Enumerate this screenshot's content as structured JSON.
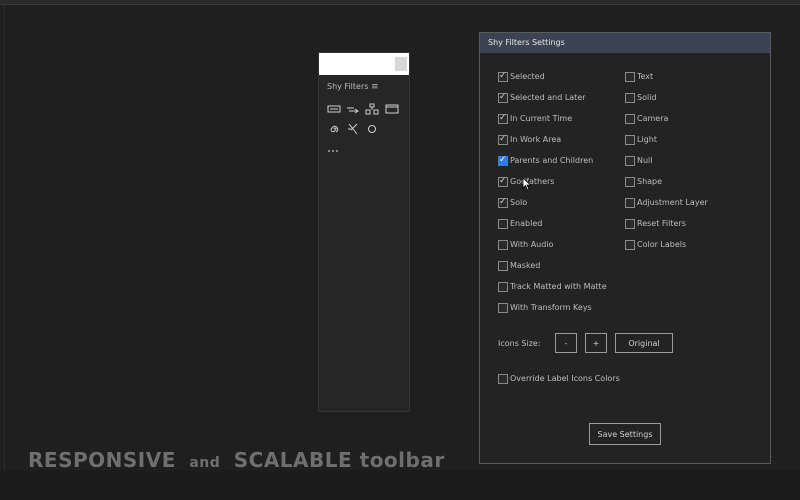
{
  "shy_panel": {
    "title": "Shy Filters",
    "menu_icon": "hamburger-menu-icon",
    "icons": [
      "text-layer-icon",
      "shape-arrow-icon",
      "hierarchy-icon",
      "film-clip-icon",
      "spiral-icon",
      "light-rays-icon",
      "circle-icon",
      "ellipsis-icon"
    ]
  },
  "settings": {
    "title": "Shy Filters Settings",
    "left_options": [
      {
        "label": "Selected",
        "checked": true
      },
      {
        "label": "Selected and Later",
        "checked": true
      },
      {
        "label": "In Current Time",
        "checked": true
      },
      {
        "label": "In Work Area",
        "checked": true
      },
      {
        "label": "Parents and Children",
        "checked": true,
        "highlight": true
      },
      {
        "label": "Godfathers",
        "checked": true
      },
      {
        "label": "Solo",
        "checked": true
      },
      {
        "label": "Enabled",
        "checked": false
      },
      {
        "label": "With Audio",
        "checked": false
      },
      {
        "label": "Masked",
        "checked": false
      },
      {
        "label": "Track Matted with Matte",
        "checked": false
      },
      {
        "label": "With Transform Keys",
        "checked": false
      }
    ],
    "right_options": [
      {
        "label": "Text",
        "checked": false
      },
      {
        "label": "Solid",
        "checked": false
      },
      {
        "label": "Camera",
        "checked": false
      },
      {
        "label": "Light",
        "checked": false
      },
      {
        "label": "Null",
        "checked": false
      },
      {
        "label": "Shape",
        "checked": false
      },
      {
        "label": "Adjustment Layer",
        "checked": false
      },
      {
        "label": "Reset Filters",
        "checked": false
      },
      {
        "label": "Color Labels",
        "checked": false
      }
    ],
    "icons_size_label": "Icons Size:",
    "minus_label": "-",
    "plus_label": "+",
    "original_label": "Original",
    "override_label": "Override Label Icons Colors",
    "override_checked": false,
    "save_label": "Save Settings"
  },
  "caption": {
    "part1": "RESPONSIVE",
    "part2": "and",
    "part3": "SCALABLE toolbar"
  },
  "colors": {
    "accent_checkbox": "#2f7de1",
    "title_bar": "#3c4352"
  }
}
